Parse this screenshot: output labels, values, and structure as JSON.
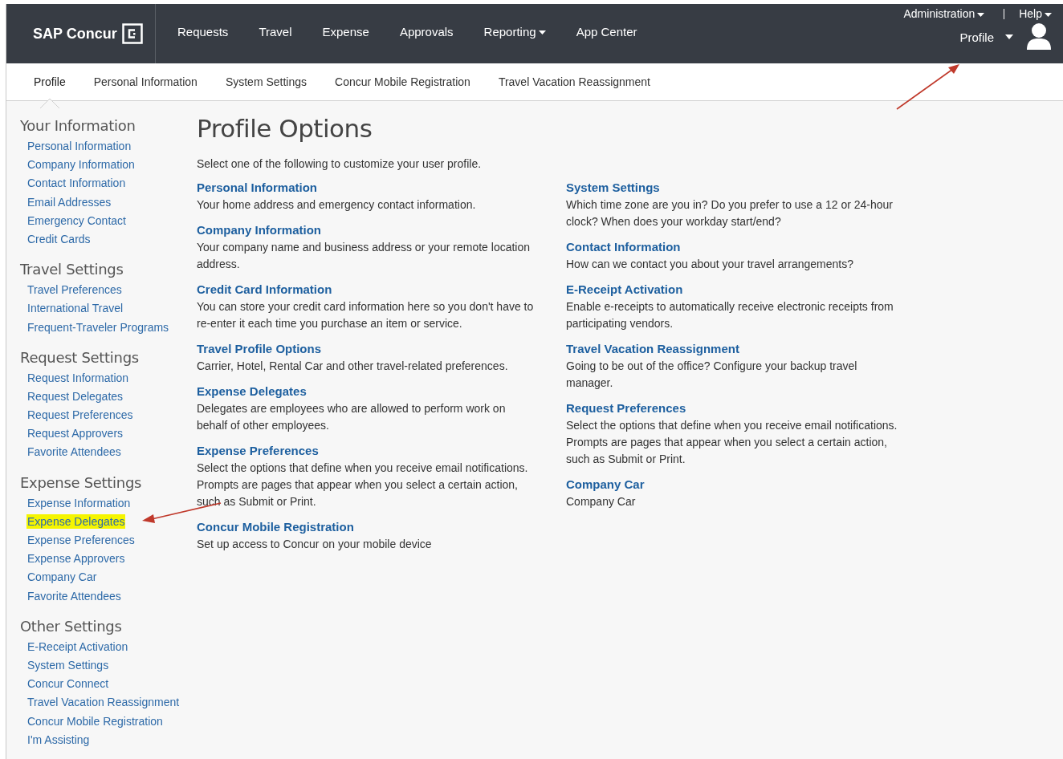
{
  "header": {
    "logo": "SAP Concur",
    "nav": [
      {
        "label": "Requests",
        "dropdown": false
      },
      {
        "label": "Travel",
        "dropdown": false
      },
      {
        "label": "Expense",
        "dropdown": false
      },
      {
        "label": "Approvals",
        "dropdown": false
      },
      {
        "label": "Reporting",
        "dropdown": true
      },
      {
        "label": "App Center",
        "dropdown": false
      }
    ],
    "utility": [
      {
        "label": "Administration",
        "dropdown": true
      },
      {
        "label": "Help",
        "dropdown": true
      }
    ],
    "profile_menu": {
      "label": "Profile",
      "pointed": true
    }
  },
  "subnav": [
    {
      "label": "Profile",
      "selected": true
    },
    {
      "label": "Personal Information",
      "selected": false
    },
    {
      "label": "System Settings",
      "selected": false
    },
    {
      "label": "Concur Mobile Registration",
      "selected": false
    },
    {
      "label": "Travel Vacation Reassignment",
      "selected": false
    }
  ],
  "sidebar": [
    {
      "heading": "Your Information",
      "items": [
        {
          "label": "Personal Information",
          "highlighted": false
        },
        {
          "label": "Company Information",
          "highlighted": false
        },
        {
          "label": "Contact Information",
          "highlighted": false
        },
        {
          "label": "Email Addresses",
          "highlighted": false
        },
        {
          "label": "Emergency Contact",
          "highlighted": false
        },
        {
          "label": "Credit Cards",
          "highlighted": false
        }
      ]
    },
    {
      "heading": "Travel Settings",
      "items": [
        {
          "label": "Travel Preferences",
          "highlighted": false
        },
        {
          "label": "International Travel",
          "highlighted": false
        },
        {
          "label": "Frequent-Traveler Programs",
          "highlighted": false
        }
      ]
    },
    {
      "heading": "Request Settings",
      "items": [
        {
          "label": "Request Information",
          "highlighted": false
        },
        {
          "label": "Request Delegates",
          "highlighted": false
        },
        {
          "label": "Request Preferences",
          "highlighted": false
        },
        {
          "label": "Request Approvers",
          "highlighted": false
        },
        {
          "label": "Favorite Attendees",
          "highlighted": false
        }
      ]
    },
    {
      "heading": "Expense Settings",
      "items": [
        {
          "label": "Expense Information",
          "highlighted": false
        },
        {
          "label": "Expense Delegates",
          "highlighted": true,
          "pointed": true
        },
        {
          "label": "Expense Preferences",
          "highlighted": false
        },
        {
          "label": "Expense Approvers",
          "highlighted": false
        },
        {
          "label": "Company Car",
          "highlighted": false
        },
        {
          "label": "Favorite Attendees",
          "highlighted": false
        }
      ]
    },
    {
      "heading": "Other Settings",
      "items": [
        {
          "label": "E-Receipt Activation",
          "highlighted": false
        },
        {
          "label": "System Settings",
          "highlighted": false
        },
        {
          "label": "Concur Connect",
          "highlighted": false
        },
        {
          "label": "Travel Vacation Reassignment",
          "highlighted": false
        },
        {
          "label": "Concur Mobile Registration",
          "highlighted": false
        },
        {
          "label": "I'm Assisting",
          "highlighted": false
        }
      ]
    }
  ],
  "main": {
    "title": "Profile Options",
    "intro": "Select one of the following to customize your user profile.",
    "columns": [
      [
        {
          "title": "Personal Information",
          "description": "Your home address and emergency contact information."
        },
        {
          "title": "Company Information",
          "description": "Your company name and business address or your remote location address."
        },
        {
          "title": "Credit Card Information",
          "description": "You can store your credit card information here so you don't have to re-enter it each time you purchase an item or service."
        },
        {
          "title": "Travel Profile Options",
          "description": "Carrier, Hotel, Rental Car and other travel-related preferences."
        },
        {
          "title": "Expense Delegates",
          "description": "Delegates are employees who are allowed to perform work on behalf of other employees."
        },
        {
          "title": "Expense Preferences",
          "description": "Select the options that define when you receive email notifications. Prompts are pages that appear when you select a certain action, such as Submit or Print."
        },
        {
          "title": "Concur Mobile Registration",
          "description": "Set up access to Concur on your mobile device"
        }
      ],
      [
        {
          "title": "System Settings",
          "description": "Which time zone are you in? Do you prefer to use a 12 or 24-hour clock? When does your workday start/end?"
        },
        {
          "title": "Contact Information",
          "description": "How can we contact you about your travel arrangements?"
        },
        {
          "title": "E-Receipt Activation",
          "description": "Enable e-receipts to automatically receive electronic receipts from participating vendors."
        },
        {
          "title": "Travel Vacation Reassignment",
          "description": "Going to be out of the office? Configure your backup travel manager."
        },
        {
          "title": "Request Preferences",
          "description": "Select the options that define when you receive email notifications. Prompts are pages that appear when you select a certain action, such as Submit or Print."
        },
        {
          "title": "Company Car",
          "description": "Company Car"
        }
      ]
    ]
  }
}
